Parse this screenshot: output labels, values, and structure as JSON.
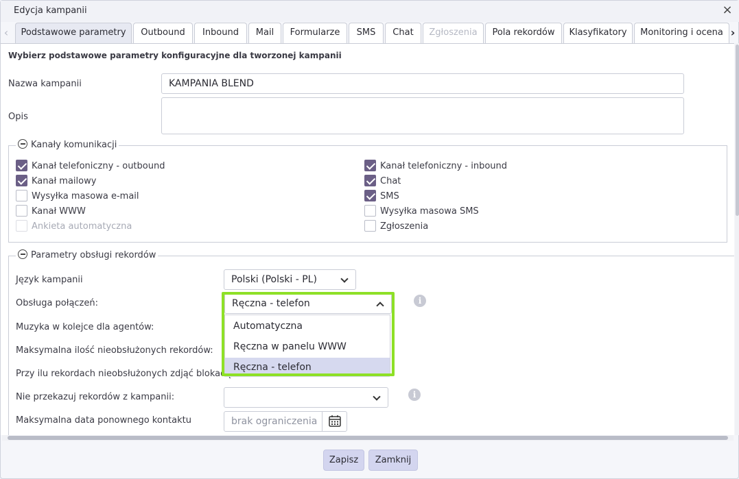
{
  "window": {
    "title": "Edycja kampanii",
    "close_glyph": "×"
  },
  "tabs": [
    {
      "label": "Podstawowe parametry",
      "state": "active"
    },
    {
      "label": "Outbound",
      "state": "normal"
    },
    {
      "label": "Inbound",
      "state": "normal"
    },
    {
      "label": "Mail",
      "state": "normal"
    },
    {
      "label": "Formularze",
      "state": "normal"
    },
    {
      "label": "SMS",
      "state": "normal"
    },
    {
      "label": "Chat",
      "state": "normal"
    },
    {
      "label": "Zgłoszenia",
      "state": "disabled"
    },
    {
      "label": "Pola rekordów",
      "state": "normal"
    },
    {
      "label": "Klasyfikatory",
      "state": "normal"
    },
    {
      "label": "Monitoring i ocena",
      "state": "normal"
    }
  ],
  "tab_arrows": {
    "left": "‹",
    "right": "›"
  },
  "intro": "Wybierz podstawowe parametry konfiguracyjne dla tworzonej kampanii",
  "campaign_name": {
    "label": "Nazwa kampanii",
    "value": "KAMPANIA BLEND"
  },
  "description": {
    "label": "Opis",
    "value": ""
  },
  "channels": {
    "legend": "Kanały komunikacji",
    "items": [
      {
        "label": "Kanał telefoniczny - outbound",
        "checked": true,
        "disabled": false
      },
      {
        "label": "Kanał mailowy",
        "checked": true,
        "disabled": false
      },
      {
        "label": "Wysyłka masowa e-mail",
        "checked": false,
        "disabled": false
      },
      {
        "label": "Kanał WWW",
        "checked": false,
        "disabled": false
      },
      {
        "label": "Ankieta automatyczna",
        "checked": false,
        "disabled": true
      },
      {
        "label": "Kanał telefoniczny - inbound",
        "checked": true,
        "disabled": false
      },
      {
        "label": "Chat",
        "checked": true,
        "disabled": false
      },
      {
        "label": "SMS",
        "checked": true,
        "disabled": false
      },
      {
        "label": "Wysyłka masowa SMS",
        "checked": false,
        "disabled": false
      },
      {
        "label": "Zgłoszenia",
        "checked": false,
        "disabled": false
      }
    ]
  },
  "records": {
    "legend": "Parametry obsługi rekordów",
    "language_label": "Język kampanii",
    "language_value": "Polski (Polski - PL)",
    "handling_label": "Obsługa połączeń:",
    "handling_value": "Ręczna - telefon",
    "handling_options": [
      "Automatyczna",
      "Ręczna w panelu WWW",
      "Ręczna - telefon"
    ],
    "handling_selected_index": 2,
    "queue_music_label": "Muzyka w kolejce dla agentów:",
    "max_unhandled_label": "Maksymalna ilość nieobsłużonych rekordów:",
    "unblock_label": "Przy ilu rekordach nieobsłużonych zdjąć blokadę:",
    "no_transfer_label": "Nie przekazuj rekordów z kampanii:",
    "no_transfer_value": "",
    "max_date_label": "Maksymalna data ponownego kontaktu",
    "max_date_placeholder": "brak ograniczenia",
    "info_glyph": "i"
  },
  "footer": {
    "save_label": "Zapisz",
    "close_label": "Zamknij"
  },
  "colors": {
    "checkbox_checked": "#6b5f86",
    "highlight": "#8ee027",
    "button": "#d3d5ef",
    "selected_option": "#d6d9ef"
  }
}
